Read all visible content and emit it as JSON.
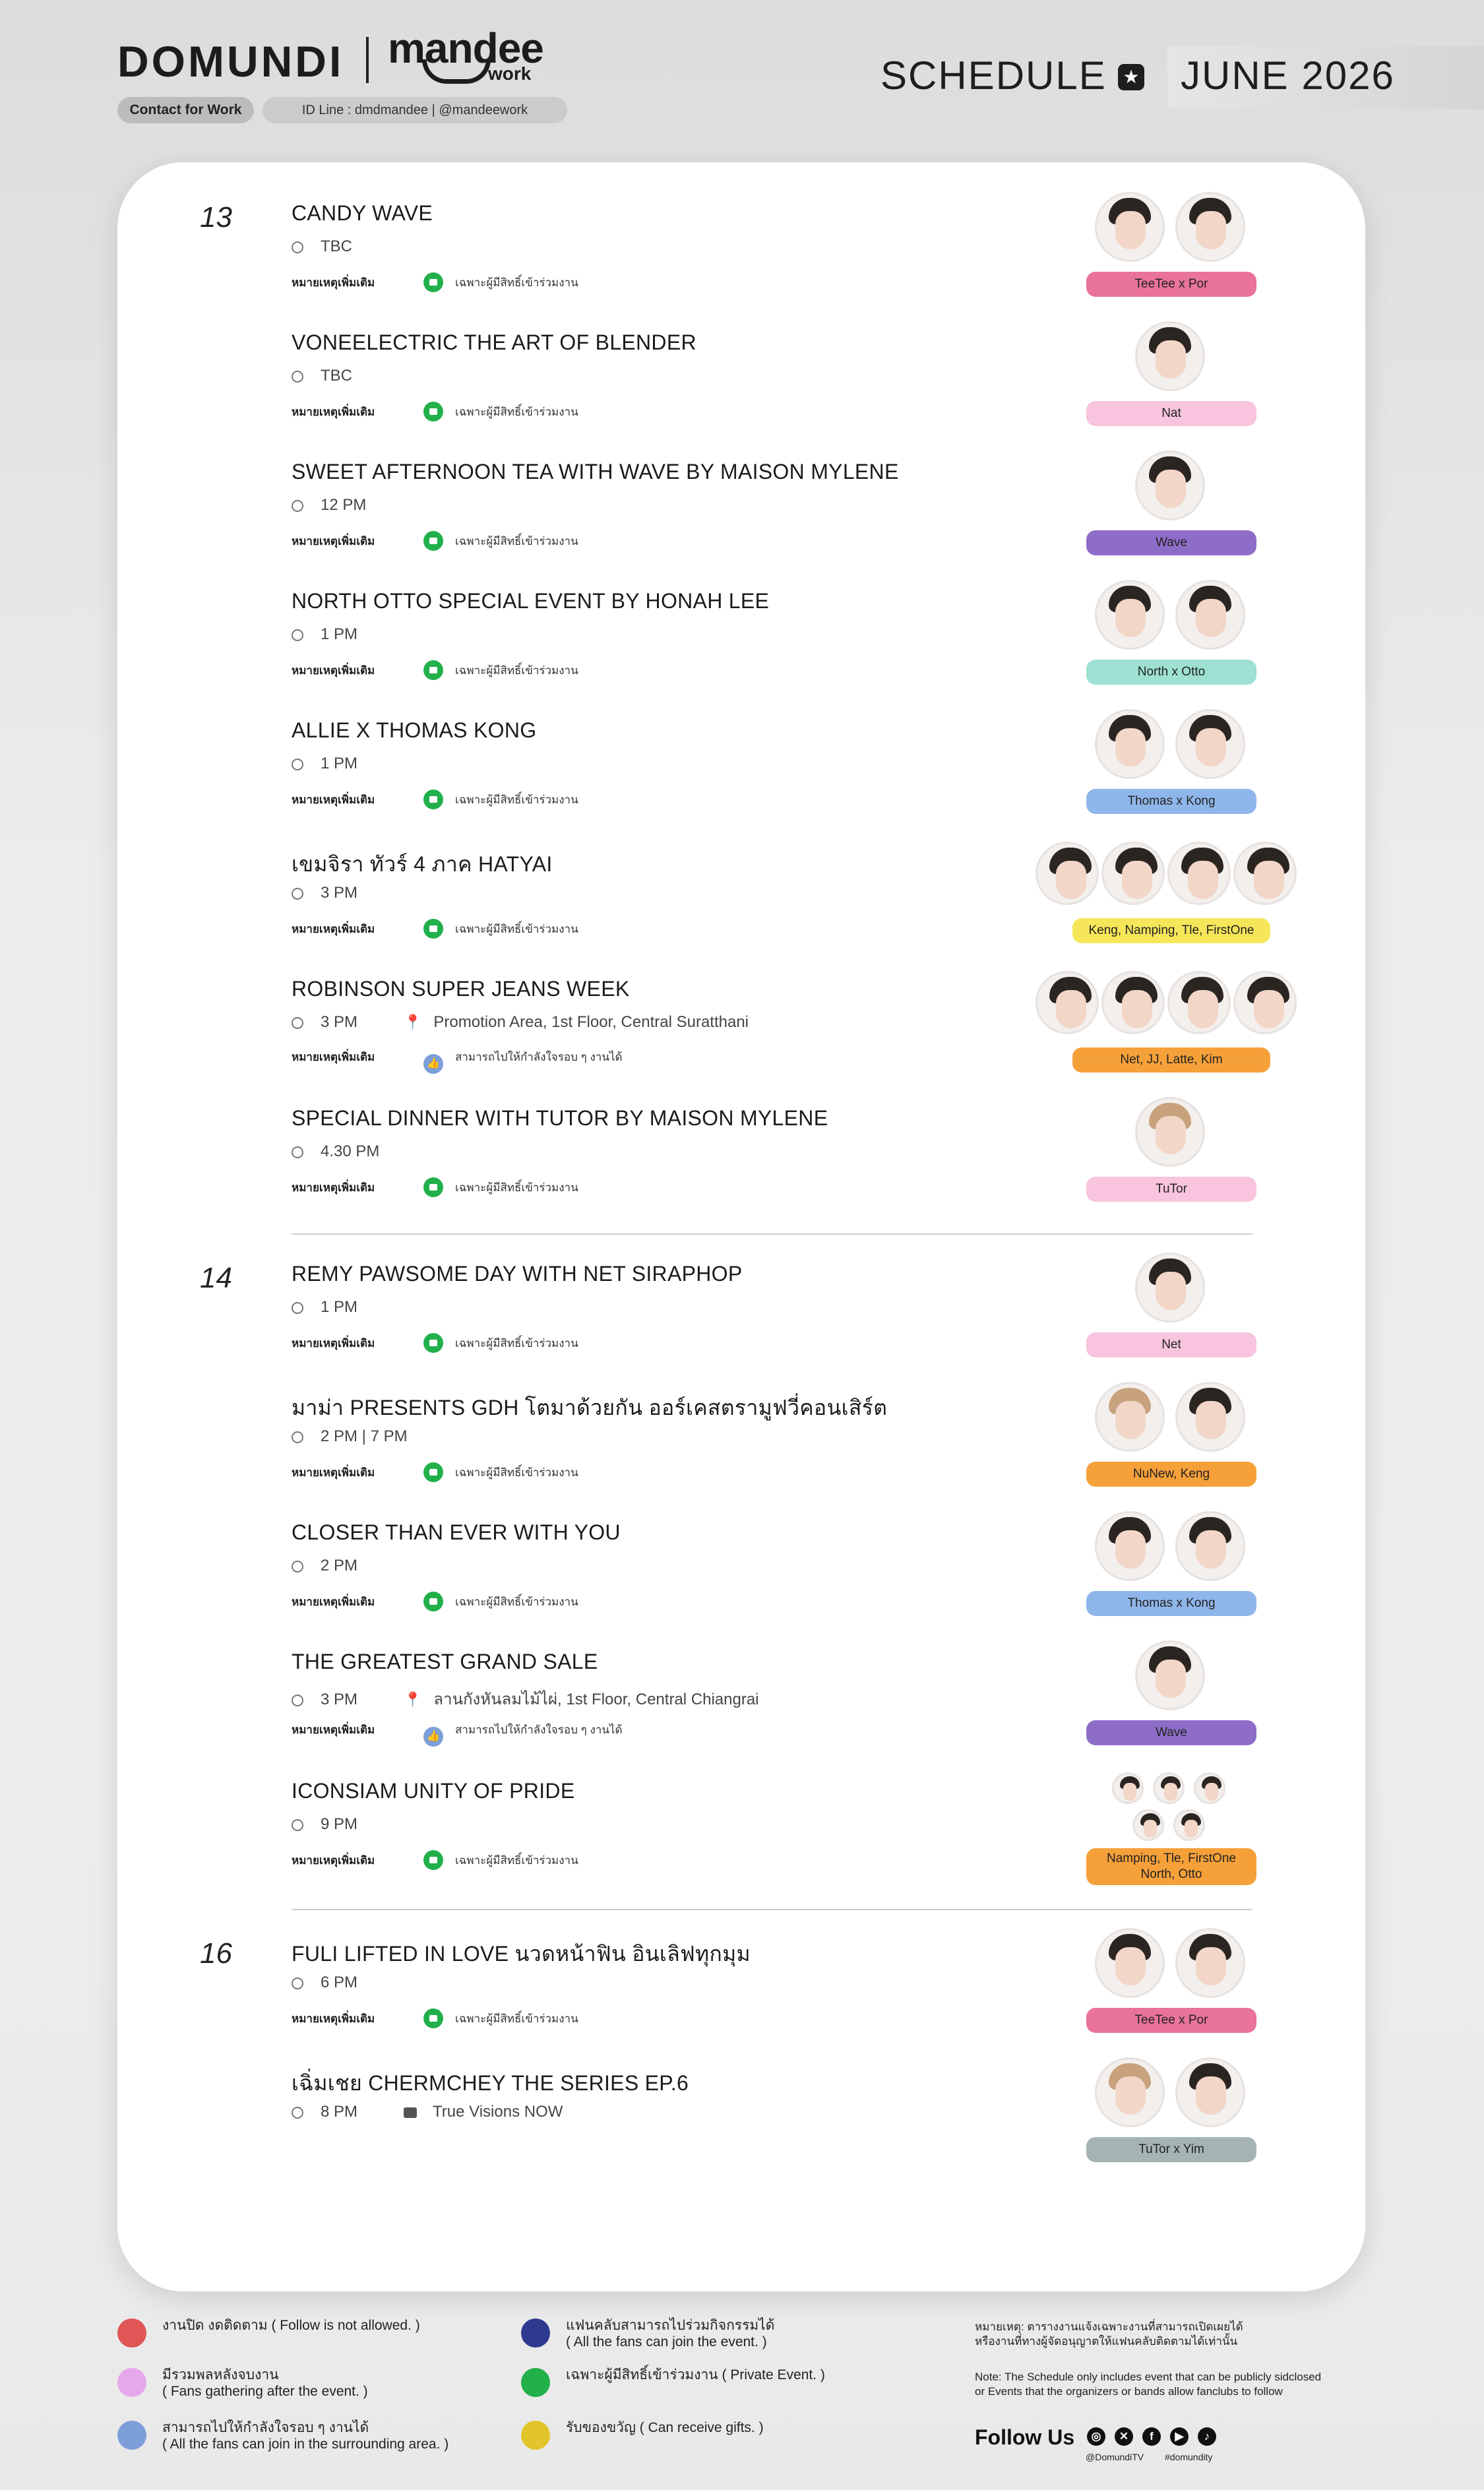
{
  "header": {
    "logo_left": "DOMUNDI",
    "logo_right": "mandee",
    "logo_right_sub": "work",
    "contact_label": "Contact for Work",
    "id_line": "ID Line : dmdmandee | @mandeework",
    "schedule_label": "SCHEDULE",
    "month_label": "JUNE 2026"
  },
  "note_label": "หมายเหตุเพิ่มเติม",
  "days": [
    {
      "label": "13"
    },
    {
      "label": "14"
    },
    {
      "label": "16"
    }
  ],
  "events": [
    {
      "title": "CANDY WAVE",
      "time": "TBC",
      "location": "",
      "note": "เฉพาะผู้มีสิทธิ์เข้าร่วมงาน",
      "note_type": "private",
      "tag": "TeeTee  x  Por",
      "tag_color": "#e9739b"
    },
    {
      "title": "VONEELECTRIC THE ART OF BLENDER",
      "time": "TBC",
      "location": "",
      "note": "เฉพาะผู้มีสิทธิ์เข้าร่วมงาน",
      "note_type": "private",
      "tag": "Nat",
      "tag_color": "#f8c4de"
    },
    {
      "title": "SWEET AFTERNOON TEA WITH WAVE BY MAISON MYLENE",
      "time": "12 PM",
      "location": "",
      "note": "เฉพาะผู้มีสิทธิ์เข้าร่วมงาน",
      "note_type": "private",
      "tag": "Wave",
      "tag_color": "#8e6dc9"
    },
    {
      "title": "NORTH OTTO SPECIAL EVENT BY HONAH LEE",
      "time": "1 PM",
      "location": "",
      "note": "เฉพาะผู้มีสิทธิ์เข้าร่วมงาน",
      "note_type": "private",
      "tag": "North  x  Otto",
      "tag_color": "#9ee0d2"
    },
    {
      "title": "ALLIE X THOMAS KONG",
      "time": "1 PM",
      "location": "",
      "note": "เฉพาะผู้มีสิทธิ์เข้าร่วมงาน",
      "note_type": "private",
      "tag": "Thomas  x  Kong",
      "tag_color": "#8fb6ea"
    },
    {
      "title": "เขมจิรา ทัวร์ 4 ภาค HATYAI",
      "time": "3 PM",
      "location": "",
      "note": "เฉพาะผู้มีสิทธิ์เข้าร่วมงาน",
      "note_type": "private",
      "tag": "Keng, Namping, Tle, FirstOne",
      "tag_color": "#f6e65a"
    },
    {
      "title": "ROBINSON SUPER JEANS WEEK",
      "time": "3 PM",
      "location": "Promotion Area, 1st Floor, Central Suratthani",
      "note": "สามารถไปให้กำลังใจรอบ ๆ งานได้",
      "note_type": "surround",
      "tag": "Net, JJ, Latte, Kim",
      "tag_color": "#f6a03a"
    },
    {
      "title": "SPECIAL DINNER WITH TUTOR BY MAISON MYLENE",
      "time": "4.30 PM",
      "location": "",
      "note": "เฉพาะผู้มีสิทธิ์เข้าร่วมงาน",
      "note_type": "private",
      "tag": "TuTor",
      "tag_color": "#f8c4de"
    },
    {
      "title": "REMY PAWSOME DAY WITH NET SIRAPHOP",
      "time": "1 PM",
      "location": "",
      "note": "เฉพาะผู้มีสิทธิ์เข้าร่วมงาน",
      "note_type": "private",
      "tag": "Net",
      "tag_color": "#f8c4de"
    },
    {
      "title": "มาม่า PRESENTS GDH โตมาด้วยกัน ออร์เคสตรามูฟวี่คอนเสิร์ต",
      "time": "2 PM  |  7 PM",
      "location": "",
      "note": "เฉพาะผู้มีสิทธิ์เข้าร่วมงาน",
      "note_type": "private",
      "tag": "NuNew, Keng",
      "tag_color": "#f6a03a"
    },
    {
      "title": "CLOSER THAN EVER WITH YOU",
      "time": "2 PM",
      "location": "",
      "note": "เฉพาะผู้มีสิทธิ์เข้าร่วมงาน",
      "note_type": "private",
      "tag": "Thomas  x  Kong",
      "tag_color": "#8fb6ea"
    },
    {
      "title": "THE GREATEST GRAND SALE",
      "time": "3 PM",
      "location": "ลานกังหันลมไม้ไผ่, 1st Floor, Central Chiangrai",
      "note": "สามารถไปให้กำลังใจรอบ ๆ งานได้",
      "note_type": "surround",
      "tag": "Wave",
      "tag_color": "#8e6dc9"
    },
    {
      "title": "ICONSIAM UNITY OF PRIDE",
      "time": "9 PM",
      "location": "",
      "note": "เฉพาะผู้มีสิทธิ์เข้าร่วมงาน",
      "note_type": "private",
      "tag": "Namping, Tle, FirstOne",
      "tag2": "North, Otto",
      "tag_color": "#f6a03a"
    },
    {
      "title": "FULI LIFTED IN LOVE นวดหน้าฟิน อินเลิฟทุกมุม",
      "time": "6 PM",
      "location": "",
      "note": "เฉพาะผู้มีสิทธิ์เข้าร่วมงาน",
      "note_type": "private",
      "tag": "TeeTee  x  Por",
      "tag_color": "#e9739b"
    },
    {
      "title": "เฉิ่มเชย CHERMCHEY THE SERIES EP.6",
      "time": "8 PM",
      "location": "True Visions NOW",
      "note": "",
      "note_type": "",
      "tag": "TuTor  x  Yim",
      "tag_color": "#a5b3b4"
    }
  ],
  "legend": [
    {
      "icon": "no-follow-icon",
      "color": "#e05555",
      "line1": "งานปิด งดติดตาม ( Follow is not allowed. )",
      "line2": ""
    },
    {
      "icon": "gathering-icon",
      "color": "#e5a8ea",
      "line1": "มีรวมพลหลังจบงาน",
      "line2": "( Fans gathering after the event. )"
    },
    {
      "icon": "thumbs-up-icon",
      "color": "#7d9fd9",
      "line1": "สามารถไปให้กำลังใจรอบ ๆ งานได้",
      "line2": "( All the fans can join in the surrounding area. )"
    },
    {
      "icon": "all-fans-icon",
      "color": "#2f3a8f",
      "line1": "แฟนคลับสามารถไปร่วมกิจกรรมได้",
      "line2": "( All the fans can join the event. )"
    },
    {
      "icon": "private-event-icon",
      "color": "#22b04b",
      "line1": "เฉพาะผู้มีสิทธิ์เข้าร่วมงาน ( Private Event. )",
      "line2": ""
    },
    {
      "icon": "gift-icon",
      "color": "#e2c52a",
      "line1": "รับของขวัญ ( Can receive gifts. )",
      "line2": ""
    }
  ],
  "footer_note": {
    "th1": "หมายเหตุ: ตารางงานแจ้งเฉพาะงานที่สามารถเปิดเผยได้",
    "th2": "หรืองานที่ทางผู้จัดอนุญาตให้แฟนคลับติดตามได้เท่านั้น",
    "en1": "Note: The Schedule only includes event that can be publicly sidclosed",
    "en2": "or Events that the organizers or bands allow fanclubs to follow"
  },
  "follow": {
    "label": "Follow Us",
    "handle1": "@DomundiTV",
    "handle2": "#domundity",
    "icons": [
      "instagram-icon",
      "x-icon",
      "facebook-icon",
      "youtube-icon",
      "tiktok-icon"
    ]
  }
}
